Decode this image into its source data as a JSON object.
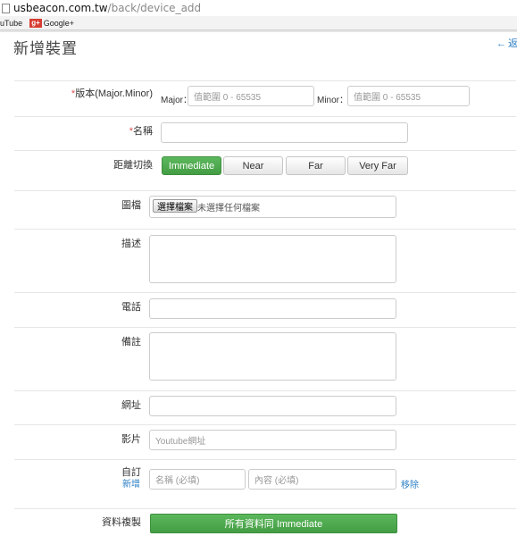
{
  "browser": {
    "url_domain": "usbeacon.com.tw",
    "url_path": "/back/device_add",
    "bookmarks": [
      {
        "label": "uTube"
      },
      {
        "badge": "g+",
        "label": "Google+"
      }
    ]
  },
  "page": {
    "title": "新增裝置",
    "back_label": "返回"
  },
  "form": {
    "version": {
      "required_mark": "*",
      "label": "版本(Major.Minor)",
      "major_label": "Major：",
      "major_placeholder": "值範圍 0 - 65535",
      "minor_label": "Minor：",
      "minor_placeholder": "值範圍 0 - 65535"
    },
    "name": {
      "required_mark": "*",
      "label": "名稱",
      "value": ""
    },
    "distance": {
      "label": "距離切換",
      "options": [
        "Immediate",
        "Near",
        "Far",
        "Very Far"
      ],
      "selected": "Immediate"
    },
    "image": {
      "label": "圖檔",
      "button_label": "選擇檔案",
      "status": "未選擇任何檔案"
    },
    "description": {
      "label": "描述",
      "value": ""
    },
    "phone": {
      "label": "電話",
      "value": ""
    },
    "note": {
      "label": "備註",
      "value": ""
    },
    "website": {
      "label": "網址",
      "value": ""
    },
    "video": {
      "label": "影片",
      "placeholder": "Youtube網址"
    },
    "custom": {
      "label": "自訂",
      "add_label": "新增",
      "name_placeholder": "名稱 (必填)",
      "content_placeholder": "內容 (必填)",
      "remove_label": "移除"
    },
    "copy": {
      "label": "資料複製",
      "button_label": "所有資料同 Immediate"
    }
  },
  "colors": {
    "accent_green": "#5cb85c",
    "link_blue": "#2a7ec3",
    "required_red": "#d9534f"
  }
}
